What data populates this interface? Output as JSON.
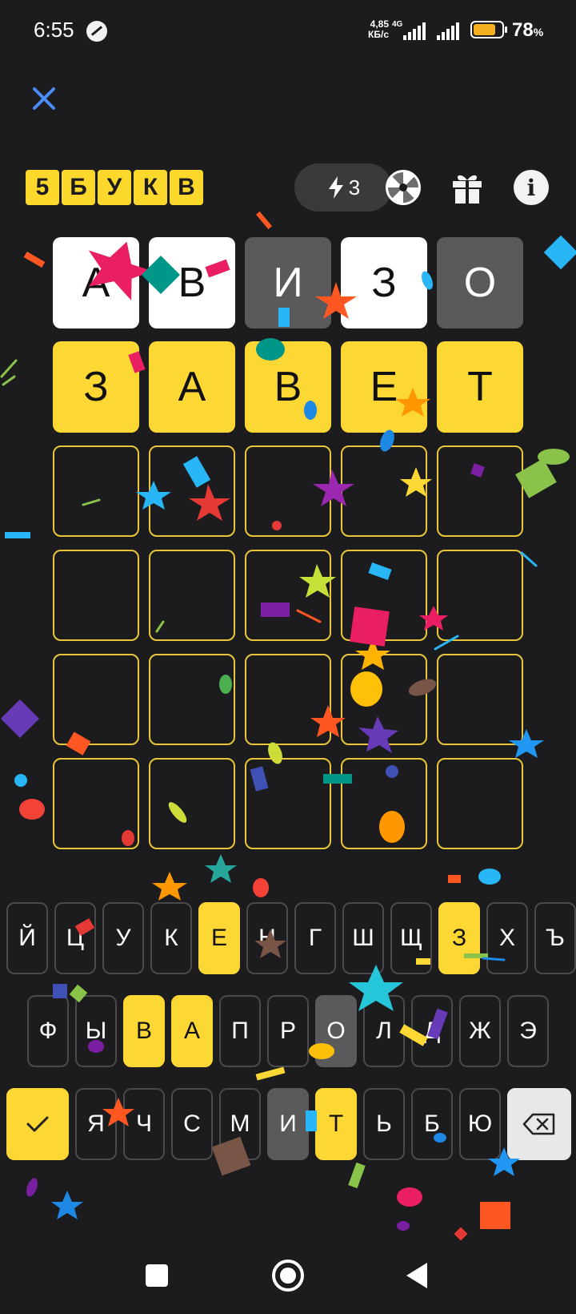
{
  "status_bar": {
    "time": "6:55",
    "net_speed_value": "4,85",
    "net_speed_unit": "КБ/с",
    "network_type": "4G",
    "battery_percent": "78",
    "battery_symbol": "%",
    "battery_level": 0.78
  },
  "header": {
    "logo_letters": [
      "5",
      "Б",
      "У",
      "К",
      "В"
    ],
    "energy_count": "3",
    "info_label": "i"
  },
  "board": {
    "rows": [
      [
        {
          "letter": "А",
          "state": "present"
        },
        {
          "letter": "В",
          "state": "present"
        },
        {
          "letter": "И",
          "state": "absent"
        },
        {
          "letter": "З",
          "state": "present"
        },
        {
          "letter": "О",
          "state": "absent"
        }
      ],
      [
        {
          "letter": "З",
          "state": "correct"
        },
        {
          "letter": "А",
          "state": "correct"
        },
        {
          "letter": "В",
          "state": "correct"
        },
        {
          "letter": "Е",
          "state": "correct"
        },
        {
          "letter": "Т",
          "state": "correct"
        }
      ],
      [
        {
          "letter": "",
          "state": "empty"
        },
        {
          "letter": "",
          "state": "empty"
        },
        {
          "letter": "",
          "state": "empty"
        },
        {
          "letter": "",
          "state": "empty"
        },
        {
          "letter": "",
          "state": "empty"
        }
      ],
      [
        {
          "letter": "",
          "state": "empty"
        },
        {
          "letter": "",
          "state": "empty"
        },
        {
          "letter": "",
          "state": "empty"
        },
        {
          "letter": "",
          "state": "empty"
        },
        {
          "letter": "",
          "state": "empty"
        }
      ],
      [
        {
          "letter": "",
          "state": "empty"
        },
        {
          "letter": "",
          "state": "empty"
        },
        {
          "letter": "",
          "state": "empty"
        },
        {
          "letter": "",
          "state": "empty"
        },
        {
          "letter": "",
          "state": "empty"
        }
      ],
      [
        {
          "letter": "",
          "state": "empty"
        },
        {
          "letter": "",
          "state": "empty"
        },
        {
          "letter": "",
          "state": "empty"
        },
        {
          "letter": "",
          "state": "empty"
        },
        {
          "letter": "",
          "state": "empty"
        }
      ]
    ]
  },
  "keyboard": {
    "rows": [
      [
        {
          "label": "Й",
          "state": "default"
        },
        {
          "label": "Ц",
          "state": "default"
        },
        {
          "label": "У",
          "state": "default"
        },
        {
          "label": "К",
          "state": "default"
        },
        {
          "label": "Е",
          "state": "correct"
        },
        {
          "label": "Н",
          "state": "default"
        },
        {
          "label": "Г",
          "state": "default"
        },
        {
          "label": "Ш",
          "state": "default"
        },
        {
          "label": "Щ",
          "state": "default"
        },
        {
          "label": "З",
          "state": "correct"
        },
        {
          "label": "Х",
          "state": "default"
        },
        {
          "label": "Ъ",
          "state": "default"
        }
      ],
      [
        {
          "label": "Ф",
          "state": "default"
        },
        {
          "label": "Ы",
          "state": "default"
        },
        {
          "label": "В",
          "state": "correct"
        },
        {
          "label": "А",
          "state": "correct"
        },
        {
          "label": "П",
          "state": "default"
        },
        {
          "label": "Р",
          "state": "default"
        },
        {
          "label": "О",
          "state": "absent"
        },
        {
          "label": "Л",
          "state": "default"
        },
        {
          "label": "Д",
          "state": "default"
        },
        {
          "label": "Ж",
          "state": "default"
        },
        {
          "label": "Э",
          "state": "default"
        }
      ],
      [
        {
          "label": "Я",
          "state": "default"
        },
        {
          "label": "Ч",
          "state": "default"
        },
        {
          "label": "С",
          "state": "default"
        },
        {
          "label": "М",
          "state": "default"
        },
        {
          "label": "И",
          "state": "absent"
        },
        {
          "label": "Т",
          "state": "correct"
        },
        {
          "label": "Ь",
          "state": "default"
        },
        {
          "label": "Б",
          "state": "default"
        },
        {
          "label": "Ю",
          "state": "default"
        }
      ]
    ],
    "enter_icon": "checkmark-icon",
    "backspace_icon": "backspace-icon"
  },
  "colors": {
    "background": "#1c1c1e",
    "correct": "#fdd835",
    "present": "#ffffff",
    "absent": "#5a5a5c",
    "close_accent": "#4a8bf5"
  },
  "icons": {
    "close": "close-icon",
    "energy": "lightning-icon",
    "wheel": "fortune-wheel-icon",
    "gift": "gift-icon",
    "info": "info-icon"
  }
}
